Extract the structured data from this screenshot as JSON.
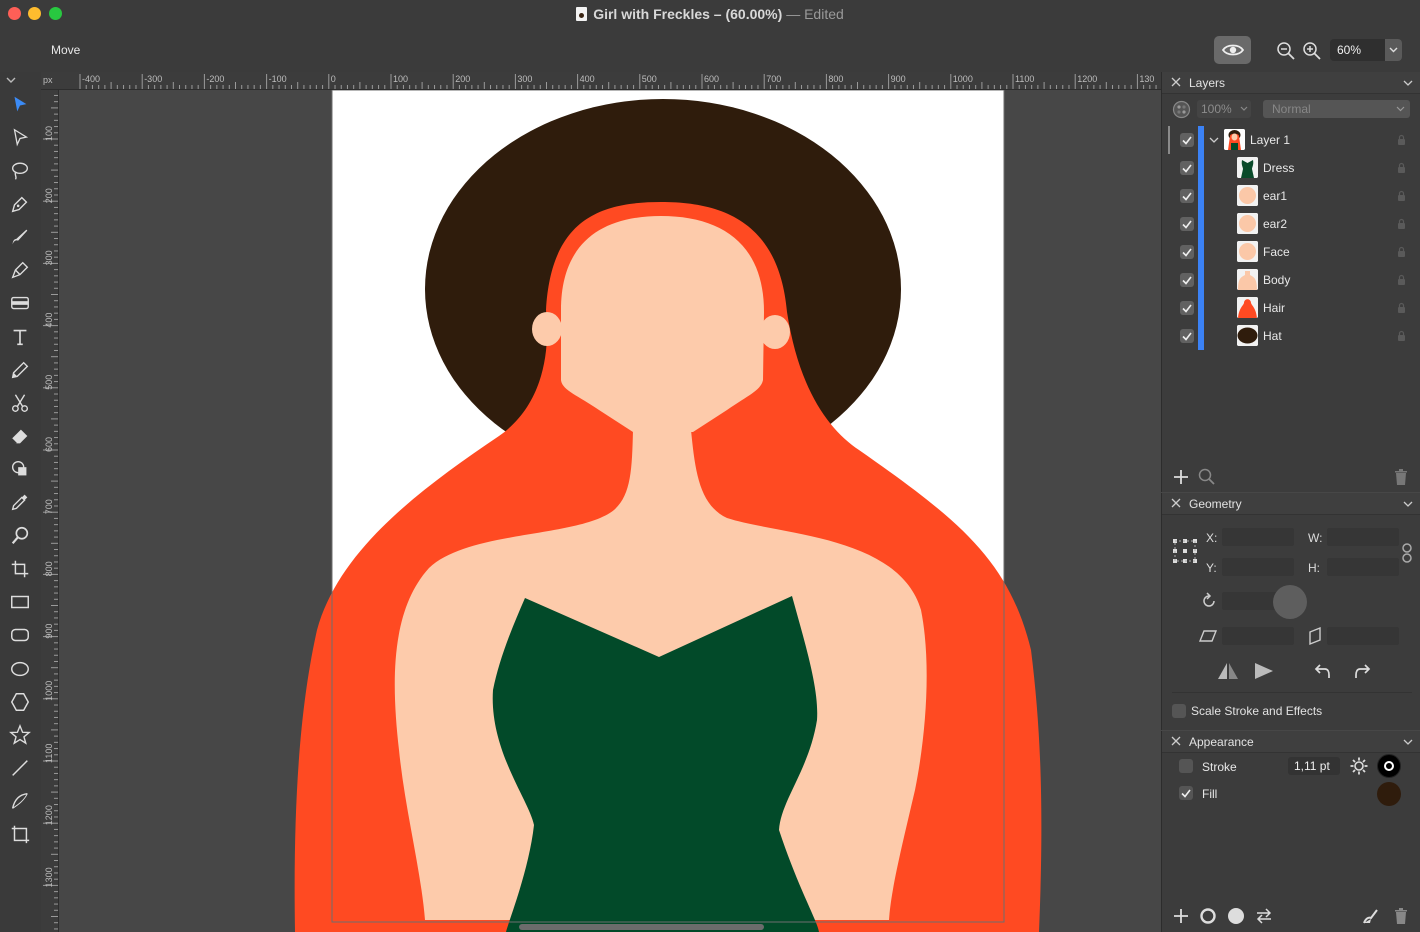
{
  "window": {
    "title": "Girl with Freckles – (60.00%)",
    "edited": "Edited"
  },
  "toolbar": {
    "tool_name": "Move",
    "zoom": "60%"
  },
  "ruler": {
    "unit": "px",
    "top_ticks": [
      "-400",
      "-300",
      "-200",
      "-100",
      "0",
      "100",
      "200",
      "300",
      "400",
      "500",
      "600",
      "700",
      "800",
      "900",
      "1000",
      "1100",
      "1200",
      "130"
    ],
    "left_ticks": [
      "100",
      "200",
      "300",
      "400",
      "500",
      "600",
      "700",
      "800",
      "900",
      "1000",
      "1100",
      "1200",
      "1300"
    ]
  },
  "tools": [
    "move-tool-icon",
    "direct-select-icon",
    "lasso-icon",
    "pen-icon",
    "brush-icon",
    "vector-brush-icon",
    "gradient-icon",
    "text-icon",
    "pencil-icon",
    "scissors-icon",
    "eraser-icon",
    "shape-builder-icon",
    "eyedropper-icon",
    "zoom-icon",
    "crop-icon",
    "rectangle-icon",
    "rounded-rect-icon",
    "ellipse-icon",
    "polygon-icon",
    "star-icon",
    "line-icon",
    "curve-icon",
    "artboard-icon"
  ],
  "layers": {
    "title": "Layers",
    "opacity": "100%",
    "blend": "Normal",
    "items": [
      {
        "name": "Layer 1",
        "thumb": "girl",
        "checked": true
      },
      {
        "name": "Dress",
        "thumb": "#0a4a2a",
        "checked": true
      },
      {
        "name": "ear1",
        "thumb": "#fbc8a8",
        "checked": true
      },
      {
        "name": "ear2",
        "thumb": "#fbc8a8",
        "checked": true
      },
      {
        "name": "Face",
        "thumb": "#fbc8a8",
        "checked": true
      },
      {
        "name": "Body",
        "thumb": "#fbc8a8",
        "checked": true
      },
      {
        "name": "Hair",
        "thumb": "#ff4a22",
        "checked": true
      },
      {
        "name": "Hat",
        "thumb": "#2f1c0c",
        "checked": true
      }
    ]
  },
  "geometry": {
    "title": "Geometry",
    "x_label": "X:",
    "y_label": "Y:",
    "w_label": "W:",
    "h_label": "H:",
    "scale_label": "Scale Stroke and Effects"
  },
  "appearance": {
    "title": "Appearance",
    "stroke_label": "Stroke",
    "stroke_value": "1,11 pt",
    "fill_label": "Fill",
    "stroke_checked": false,
    "fill_checked": true,
    "fill_color": "#2f1c0c"
  },
  "colors": {
    "hat": "#2f1c0c",
    "hair": "#ff4a22",
    "skin": "#fdcbab",
    "dress": "#024a29",
    "accent": "#3b82f6"
  }
}
